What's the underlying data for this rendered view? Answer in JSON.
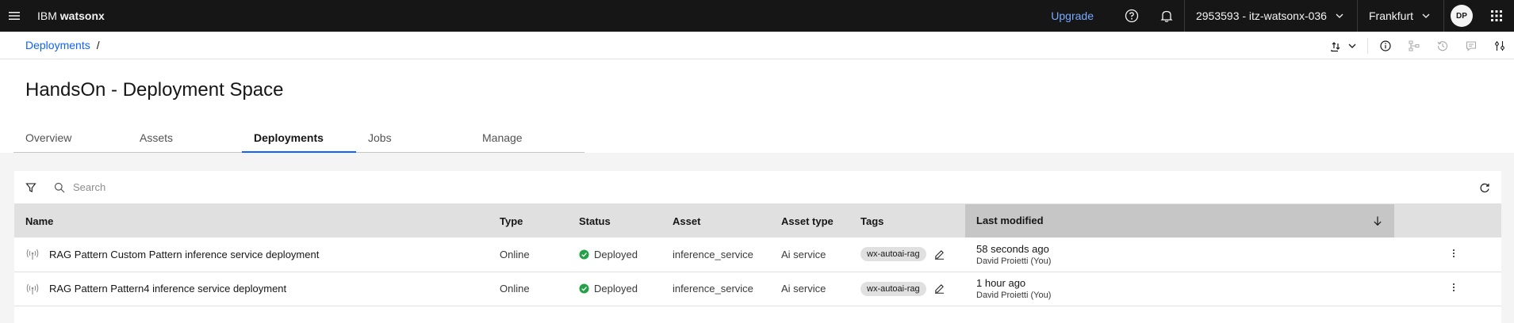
{
  "header": {
    "brand_prefix": "IBM",
    "brand_name": "watsonx",
    "upgrade": "Upgrade",
    "account": "2953593 - itz-watsonx-036",
    "region": "Frankfurt",
    "avatar_initials": "DP"
  },
  "breadcrumb": {
    "link": "Deployments",
    "separator": "/"
  },
  "page": {
    "title": "HandsOn - Deployment Space",
    "tabs": [
      {
        "label": "Overview"
      },
      {
        "label": "Assets"
      },
      {
        "label": "Deployments",
        "active": true
      },
      {
        "label": "Jobs"
      },
      {
        "label": "Manage"
      }
    ]
  },
  "search": {
    "placeholder": "Search"
  },
  "table": {
    "columns": {
      "name": "Name",
      "type": "Type",
      "status": "Status",
      "asset": "Asset",
      "asset_type": "Asset type",
      "tags": "Tags",
      "last_modified": "Last modified"
    },
    "rows": [
      {
        "name": "RAG Pattern Custom Pattern inference service deployment",
        "type": "Online",
        "status": "Deployed",
        "asset": "inference_service",
        "asset_type": "Ai service",
        "tag": "wx-autoai-rag",
        "modified": "58 seconds ago",
        "modified_by": "David Proietti (You)"
      },
      {
        "name": "RAG Pattern Pattern4 inference service deployment",
        "type": "Online",
        "status": "Deployed",
        "asset": "inference_service",
        "asset_type": "Ai service",
        "tag": "wx-autoai-rag",
        "modified": "1 hour ago",
        "modified_by": "David Proietti (You)"
      }
    ]
  },
  "colors": {
    "header_bg": "#161616",
    "link": "#0f62fe",
    "upgrade": "#78a9ff",
    "success": "#24a148"
  },
  "icons": [
    "menu-icon",
    "help-icon",
    "notification-icon",
    "chevron-down-icon",
    "app-switcher-icon",
    "upload-icon",
    "info-icon",
    "lineage-icon",
    "history-icon",
    "comment-icon",
    "settings-adjust-icon",
    "filter-icon",
    "search-icon",
    "refresh-icon",
    "broadcast-icon",
    "checkmark-filled-icon",
    "edit-icon",
    "arrow-down-icon",
    "overflow-menu-icon"
  ]
}
